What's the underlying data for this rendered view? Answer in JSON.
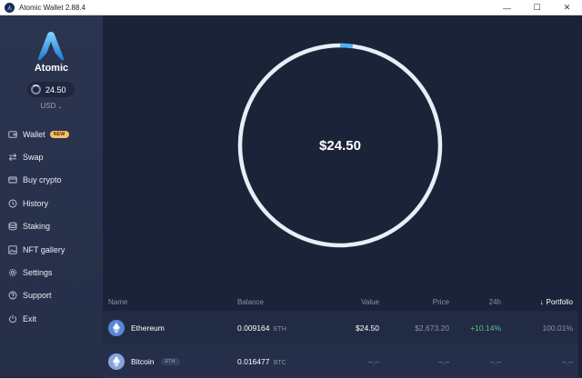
{
  "window": {
    "title": "Atomic Wallet 2.88.4"
  },
  "controls": {
    "minimize": "—",
    "maximize": "☐",
    "close": "✕"
  },
  "sidebar": {
    "brand": "Atomic",
    "balance": "24.50",
    "currency": "USD",
    "items": [
      {
        "label": "Wallet",
        "icon": "wallet-icon",
        "badge": "NEW"
      },
      {
        "label": "Swap",
        "icon": "swap-icon"
      },
      {
        "label": "Buy crypto",
        "icon": "card-icon"
      },
      {
        "label": "History",
        "icon": "history-icon"
      },
      {
        "label": "Staking",
        "icon": "staking-icon"
      },
      {
        "label": "NFT gallery",
        "icon": "image-icon"
      },
      {
        "label": "Settings",
        "icon": "gear-icon"
      },
      {
        "label": "Support",
        "icon": "question-icon"
      },
      {
        "label": "Exit",
        "icon": "power-icon"
      }
    ]
  },
  "portfolio": {
    "total": "$24.50",
    "donut": {
      "segment_fraction": 0.02,
      "ring_color": "#e8eef7",
      "accent_color": "#4fb3f0"
    }
  },
  "table": {
    "headers": {
      "name": "Name",
      "balance": "Balance",
      "value": "Value",
      "price": "Price",
      "change": "24h",
      "portfolio": "Portfolio"
    },
    "rows": [
      {
        "name": "Ethereum",
        "balance": "0.009164",
        "ticker": "ETH",
        "value": "$24.50",
        "price": "$2,673.20",
        "change": "+10.14%",
        "portfolio": "100.01%"
      },
      {
        "name": "Bitcoin",
        "tag": "ETH",
        "balance": "0.016477",
        "ticker": "BTC",
        "value": "–.–",
        "price": "–.–",
        "change": "–.–",
        "portfolio": "–.–"
      }
    ]
  }
}
